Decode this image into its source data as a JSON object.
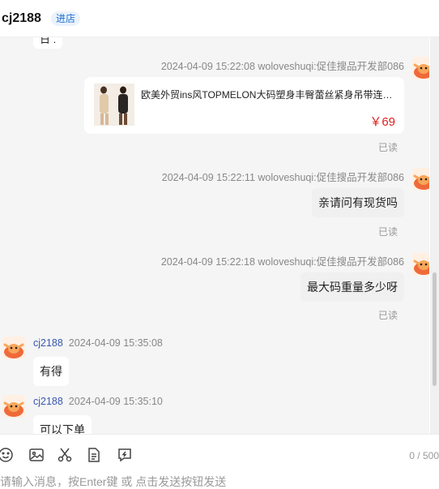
{
  "header": {
    "title": "cj2188",
    "shop_button": "进店"
  },
  "chat": {
    "partial_bubble_text": "日 .",
    "messages": [
      {
        "meta": "2024-04-09 15:22:08   woloveshuqi:促佳搜品开发部086",
        "read": "已读",
        "product": {
          "name": "欧美外贸ins风TOPMELON大码塑身丰臀蕾丝紧身吊带连体衣女",
          "price": "￥69"
        }
      },
      {
        "meta": "2024-04-09 15:22:11   woloveshuqi:促佳搜品开发部086",
        "text": "亲请问有现货吗",
        "read": "已读"
      },
      {
        "meta": "2024-04-09 15:22:18   woloveshuqi:促佳搜品开发部086",
        "text": "最大码重量多少呀",
        "read": "已读"
      },
      {
        "name": "cj2188",
        "time": "2024-04-09 15:35:08",
        "text": "有得"
      },
      {
        "name": "cj2188",
        "time": "2024-04-09 15:35:10",
        "text": "可以下单"
      }
    ]
  },
  "toolbar": {
    "icons": [
      "emoji-icon",
      "image-icon",
      "scissors-icon",
      "file-icon",
      "quick-reply-icon"
    ],
    "counter": "0 / 500"
  },
  "input": {
    "placeholder": "请输入消息，按Enter键 或 点击发送按钮发送"
  }
}
